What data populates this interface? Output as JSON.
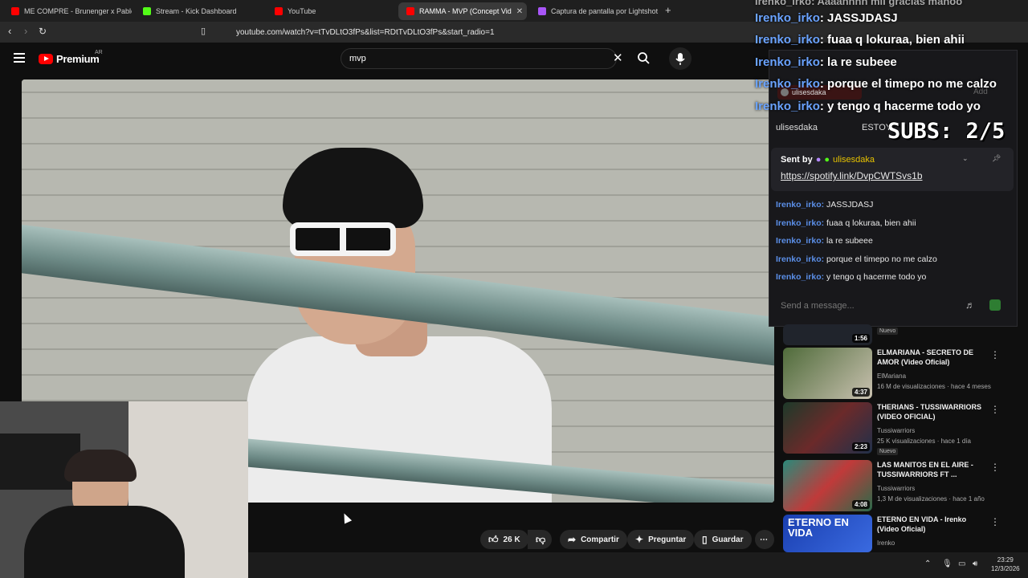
{
  "browser": {
    "tabs": [
      {
        "label": "ME COMPRE - Brunenger x Pablo No",
        "color": "#ff0000"
      },
      {
        "label": "Stream - Kick Dashboard",
        "color": "#53fc18"
      },
      {
        "label": "YouTube",
        "color": "#ff0000"
      },
      {
        "label": "RAMMA - MVP (Concept Vid",
        "color": "#ff0000"
      },
      {
        "label": "Captura de pantalla por Lightshot",
        "color": "#a855f7"
      }
    ],
    "url": "youtube.com/watch?v=tTvDLtO3fPs&list=RDtTvDLtO3fPs&start_radio=1"
  },
  "youtube": {
    "logo": "Premium",
    "region": "AR",
    "search_value": "mvp",
    "actions": {
      "likes": "26 K",
      "share": "Compartir",
      "ask": "Preguntar",
      "save": "Guardar"
    }
  },
  "overlay": {
    "subs": "SUBS: 2/5",
    "big_chat": [
      {
        "user": "Irenko_irko",
        "msg": "JASSJDASJ"
      },
      {
        "user": "Irenko_irko",
        "msg": "fuaa q lokuraa, bien ahii"
      },
      {
        "user": "Irenko_irko",
        "msg": "la re subeee"
      },
      {
        "user": "Irenko_irko",
        "msg": "porque el timepo no me calzo"
      },
      {
        "user": "Irenko_irko",
        "msg": "y tengo q hacerme todo yo"
      }
    ],
    "top_partial": "Irenko_irko: Aaaahhhh mil gracias manoo"
  },
  "chat": {
    "tab_user": "ulisesdaka",
    "add_label": "Add",
    "channel": "ulisesdaka",
    "status_text": "ESTOY",
    "sent_by_label": "Sent by",
    "sent_by_user": "ulisesdaka",
    "link": "https://spotify.link/DvpCWTSvs1b",
    "messages": [
      {
        "user": "Irenko_irko:",
        "msg": "JASSJDASJ"
      },
      {
        "user": "Irenko_irko:",
        "msg": "fuaa q lokuraa, bien ahii"
      },
      {
        "user": "Irenko_irko:",
        "msg": "la re subeee"
      },
      {
        "user": "Irenko_irko:",
        "msg": "porque el timepo no me calzo"
      },
      {
        "user": "Irenko_irko:",
        "msg": "y tengo q hacerme todo yo"
      }
    ],
    "placeholder": "Send a message..."
  },
  "recommendations": [
    {
      "title": "",
      "channel": "",
      "meta": "",
      "duration": "1:56",
      "badge": "Nuevo"
    },
    {
      "title": "ELMARIANA - SECRETO DE AMOR (Video Oficial)",
      "channel": "ElMariana",
      "meta": "16 M de visualizaciones · hace 4 meses",
      "duration": "4:37",
      "badge": ""
    },
    {
      "title": "THERIANS - TUSSIWARRIORS (VIDEO OFICIAL)",
      "channel": "Tussiwarriors",
      "meta": "25 K visualizaciones · hace 1 día",
      "duration": "2:23",
      "badge": "Nuevo"
    },
    {
      "title": "LAS MANITOS EN EL AIRE - TUSSIWARRIORS FT ...",
      "channel": "Tussiwarriors",
      "meta": "1,3 M de visualizaciones · hace 1 año",
      "duration": "4:08",
      "badge": ""
    },
    {
      "title": "ETERNO EN VIDA - Irenko (Video Oficial)",
      "channel": "Irenko",
      "meta": "",
      "duration": "",
      "badge": ""
    }
  ],
  "taskbar": {
    "time": "23:29",
    "date": "12/3/2026"
  }
}
